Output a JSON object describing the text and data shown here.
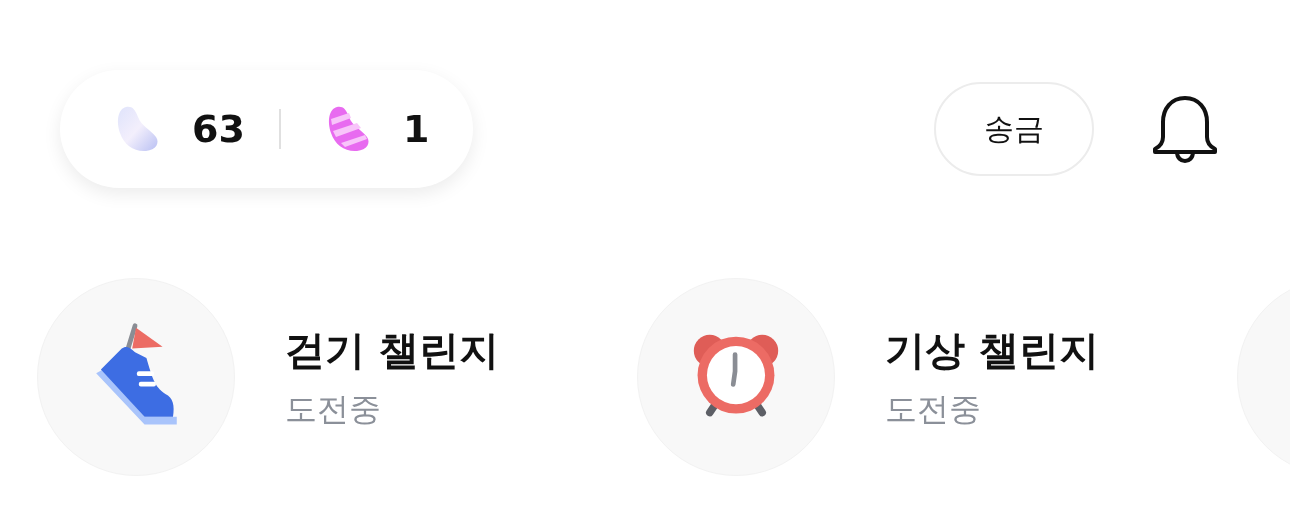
{
  "balance": {
    "items": [
      {
        "kind": "plain_bean",
        "amount": "63"
      },
      {
        "kind": "striped_bean",
        "amount": "1"
      }
    ]
  },
  "send_button": {
    "label": "송금"
  },
  "challenges": [
    {
      "kind": "walking",
      "title": "걷기 챌린지",
      "status": "도전중"
    },
    {
      "kind": "wakeup",
      "title": "기상 챌린지",
      "status": "도전중"
    }
  ]
}
